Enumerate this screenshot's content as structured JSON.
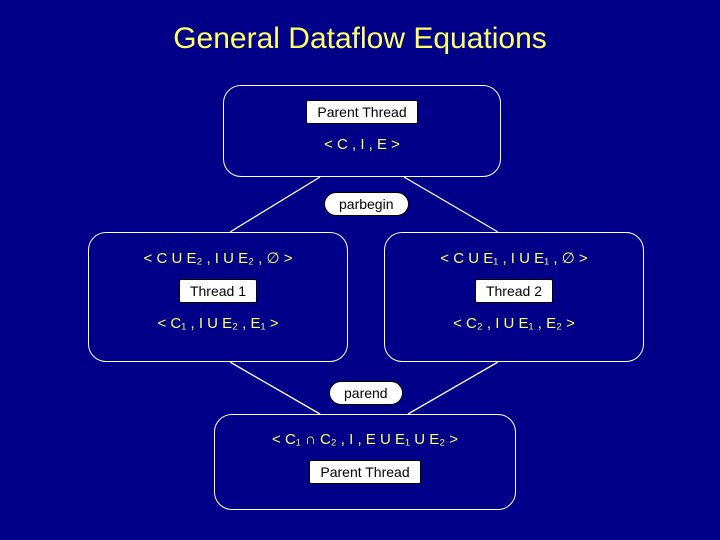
{
  "title": "General Dataflow Equations",
  "parbegin": "parbegin",
  "parend": "parend",
  "parent_top": {
    "label": "Parent Thread",
    "tuple": "< C  , I ,  E >"
  },
  "thread1": {
    "in_tuple": "< C U E₂ , I U E₂ , ∅ >",
    "label": "Thread 1",
    "out_tuple": "< C₁ , I U E₂ , E₁ >"
  },
  "thread2": {
    "in_tuple": "< C U E₁ , I U E₁ , ∅ >",
    "label": "Thread 2",
    "out_tuple": "< C₂ , I U E₁ , E₂ >"
  },
  "parent_bot": {
    "tuple": "< C₁ ∩ C₂ , I , E U E₁ U E₂ >",
    "label": "Parent Thread"
  }
}
